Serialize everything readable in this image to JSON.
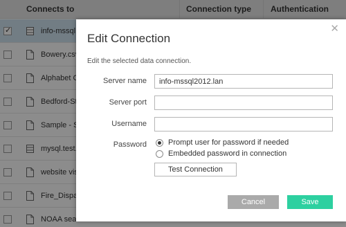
{
  "table": {
    "columns": [
      "Connects to",
      "Connection type",
      "Authentication"
    ],
    "rows": [
      {
        "text": "info-mssql",
        "icon": "database-icon",
        "checked": true
      },
      {
        "text": "Bowery.csv",
        "icon": "file-icon",
        "checked": false
      },
      {
        "text": "Alphabet C",
        "icon": "file-icon",
        "checked": false
      },
      {
        "text": "Bedford-St",
        "icon": "file-icon",
        "checked": false
      },
      {
        "text": "Sample - S",
        "icon": "file-icon",
        "checked": false
      },
      {
        "text": "mysql.test.",
        "icon": "database-icon",
        "checked": false
      },
      {
        "text": "website vis",
        "icon": "file-icon",
        "checked": false
      },
      {
        "text": "Fire_Dispa",
        "icon": "file-icon",
        "checked": false
      },
      {
        "text": "NOAA sea",
        "icon": "file-icon",
        "checked": false
      }
    ]
  },
  "dialog": {
    "title": "Edit Connection",
    "close_symbol": "✕",
    "subtitle": "Edit the selected data connection.",
    "server_name_label": "Server name",
    "server_name_value": "info-mssql2012.lan",
    "server_port_label": "Server port",
    "server_port_value": "",
    "username_label": "Username",
    "username_value": "",
    "password_label": "Password",
    "password_option_prompt": "Prompt user for password if needed",
    "password_option_embedded": "Embedded password in connection",
    "test_button": "Test Connection",
    "cancel_button": "Cancel",
    "save_button": "Save"
  },
  "colors": {
    "save": "#2dd0a0",
    "cancel": "#aaaaaa",
    "selected_row": "#cfe3f0",
    "header": "#e6e6e6"
  }
}
